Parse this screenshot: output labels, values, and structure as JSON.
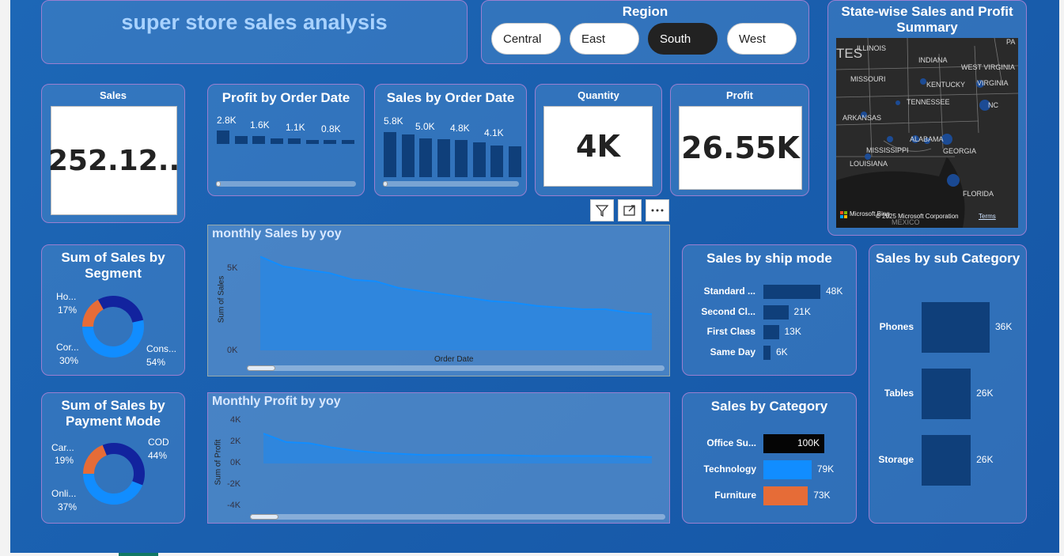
{
  "title": "super store sales analysis",
  "region": {
    "title": "Region",
    "options": [
      "Central",
      "East",
      "South",
      "West"
    ],
    "selected": "South"
  },
  "map": {
    "title": "State-wise Sales and Profit Summary",
    "states": [
      "ILLINOIS",
      "INDIANA",
      "MISSOURI",
      "KENTUCKY",
      "WEST VIRGINIA",
      "VIRGINIA",
      "TENNESSEE",
      "NC",
      "ARKANSAS",
      "ALABAMA",
      "MISSISSIPPI",
      "GEORGIA",
      "LOUISIANA",
      "FLORIDA",
      "PA",
      "MEXICO",
      "TES"
    ],
    "brand": "Microsoft Bing",
    "copyright": "© 2025 Microsoft Corporation",
    "terms": "Terms"
  },
  "kpi": {
    "sales": {
      "title": "Sales",
      "value": "252.12.."
    },
    "quantity": {
      "title": "Quantity",
      "value": "4K"
    },
    "profit": {
      "title": "Profit",
      "value": "26.55K"
    }
  },
  "profit_by_date": {
    "title": "Profit by Order Date",
    "labels": [
      "2.8K",
      "1.6K",
      "1.1K",
      "0.8K"
    ],
    "values": [
      2.8,
      1.6,
      1.6,
      1.1,
      1.1,
      0.8,
      0.8,
      0.8
    ]
  },
  "sales_by_date": {
    "title": "Sales by Order Date",
    "labels": [
      "5.8K",
      "5.0K",
      "4.8K",
      "4.1K"
    ],
    "values": [
      5.8,
      5.5,
      5.0,
      4.9,
      4.8,
      4.5,
      4.1,
      4.0
    ]
  },
  "monthly_sales": {
    "title": "monthly Sales by yoy",
    "ylabel": "Sum of Sales",
    "xlabel": "Order Date",
    "ticks": [
      "5K",
      "0K"
    ]
  },
  "monthly_profit": {
    "title": "Monthly Profit by yoy",
    "ylabel": "Sum of Profit",
    "ticks": [
      "4K",
      "2K",
      "0K",
      "-2K",
      "-4K"
    ]
  },
  "segment": {
    "title": "Sum of Sales by Segment",
    "labels": [
      {
        "name": "Ho...",
        "pct": "17%"
      },
      {
        "name": "Cor...",
        "pct": "30%"
      },
      {
        "name": "Cons...",
        "pct": "54%"
      }
    ]
  },
  "payment": {
    "title": "Sum of Sales by Payment Mode",
    "labels": [
      {
        "name": "Car...",
        "pct": "19%"
      },
      {
        "name": "Onli...",
        "pct": "37%"
      },
      {
        "name": "COD",
        "pct": "44%"
      }
    ]
  },
  "ship_mode": {
    "title": "Sales by ship mode",
    "rows": [
      {
        "label": "Standard ...",
        "value": "48K",
        "num": 48
      },
      {
        "label": "Second Cl...",
        "value": "21K",
        "num": 21
      },
      {
        "label": "First Class",
        "value": "13K",
        "num": 13
      },
      {
        "label": "Same Day",
        "value": "6K",
        "num": 6
      }
    ]
  },
  "category": {
    "title": "Sales by Category",
    "rows": [
      {
        "label": "Office Su...",
        "value": "100K",
        "num": 100,
        "color": "#050505"
      },
      {
        "label": "Technology",
        "value": "79K",
        "num": 79,
        "color": "#118dff"
      },
      {
        "label": "Furniture",
        "value": "73K",
        "num": 73,
        "color": "#e66c37"
      }
    ]
  },
  "sub_category": {
    "title": "Sales by sub Category",
    "rows": [
      {
        "label": "Phones",
        "value": "36K",
        "num": 36
      },
      {
        "label": "Tables",
        "value": "26K",
        "num": 26
      },
      {
        "label": "Storage",
        "value": "26K",
        "num": 26
      }
    ]
  },
  "colors": {
    "accent": "#118dff",
    "dark_series": "#12239e",
    "orange": "#e66c37",
    "bar_navy": "#0f3f7a"
  },
  "chart_data": [
    {
      "type": "bar",
      "title": "Profit by Order Date",
      "categories": [
        "1",
        "2",
        "3",
        "4",
        "5",
        "6",
        "7",
        "8"
      ],
      "values": [
        2.8,
        1.6,
        1.6,
        1.1,
        1.1,
        0.8,
        0.8,
        0.8
      ]
    },
    {
      "type": "bar",
      "title": "Sales by Order Date",
      "categories": [
        "1",
        "2",
        "3",
        "4",
        "5",
        "6",
        "7",
        "8"
      ],
      "values": [
        5.8,
        5.5,
        5.0,
        4.9,
        4.8,
        4.5,
        4.1,
        4.0
      ]
    },
    {
      "type": "area",
      "title": "monthly Sales by yoy",
      "xlabel": "Order Date",
      "ylabel": "Sum of Sales",
      "ylim": [
        0,
        5
      ],
      "values": [
        5.7,
        5.1,
        4.9,
        4.7,
        4.3,
        4.2,
        3.8,
        3.6,
        3.4,
        3.2,
        3.0,
        2.9,
        2.7,
        2.6,
        2.5,
        2.5,
        2.3,
        2.2
      ]
    },
    {
      "type": "area",
      "title": "Monthly Profit by yoy",
      "ylabel": "Sum of Profit",
      "ylim": [
        -4,
        4
      ],
      "values": [
        2.8,
        2.0,
        1.9,
        1.5,
        1.2,
        1.0,
        0.9,
        0.8,
        0.8,
        0.8,
        0.8,
        0.75,
        0.7,
        0.7,
        0.7,
        0.7,
        0.65,
        0.6
      ]
    },
    {
      "type": "pie",
      "title": "Sum of Sales by Segment",
      "categories": [
        "Home Office",
        "Corporate",
        "Consumer"
      ],
      "values": [
        17,
        30,
        54
      ]
    },
    {
      "type": "pie",
      "title": "Sum of Sales by Payment Mode",
      "categories": [
        "Cards",
        "Online",
        "COD"
      ],
      "values": [
        19,
        37,
        44
      ]
    },
    {
      "type": "bar",
      "title": "Sales by ship mode",
      "categories": [
        "Standard Class",
        "Second Class",
        "First Class",
        "Same Day"
      ],
      "values": [
        48,
        21,
        13,
        6
      ]
    },
    {
      "type": "bar",
      "title": "Sales by Category",
      "categories": [
        "Office Supplies",
        "Technology",
        "Furniture"
      ],
      "values": [
        100,
        79,
        73
      ]
    },
    {
      "type": "bar",
      "title": "Sales by sub Category",
      "categories": [
        "Phones",
        "Tables",
        "Storage"
      ],
      "values": [
        36,
        26,
        26
      ]
    }
  ]
}
